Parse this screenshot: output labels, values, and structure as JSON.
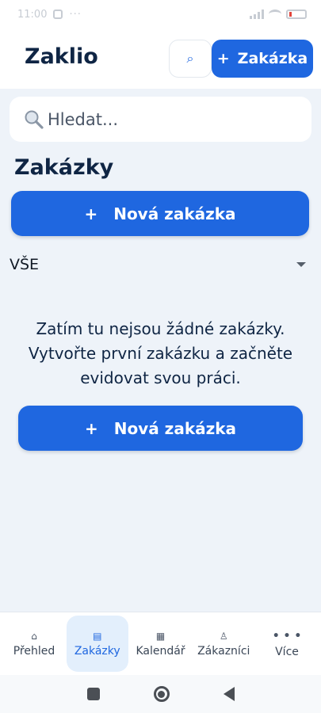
{
  "status_bar": {
    "time": "11:00",
    "dots": "···"
  },
  "header": {
    "app_title": "Zaklio",
    "search_icon": "⌕",
    "add_button_icon": "+",
    "add_button_label": "Zakázka"
  },
  "search": {
    "placeholder": "Hledat..."
  },
  "main": {
    "title": "Zakázky",
    "new_button_icon": "+",
    "new_button_label": "Nová zakázka",
    "filter_value": "VŠE",
    "empty_message": "Zatím tu nejsou žádné zakázky. Vytvořte první zakázku a začněte evidovat svou práci.",
    "empty_button_icon": "+",
    "empty_button_label": "Nová zakázka"
  },
  "bottom_nav": {
    "items": [
      {
        "label": "Přehled",
        "icon": "⌂",
        "icon_name": "home-icon"
      },
      {
        "label": "Zakázky",
        "icon": "▤",
        "icon_name": "list-icon"
      },
      {
        "label": "Kalendář",
        "icon": "▦",
        "icon_name": "calendar-icon"
      },
      {
        "label": "Zákazníci",
        "icon": "♙",
        "icon_name": "person-icon"
      },
      {
        "label": "Více",
        "icon": "• • •",
        "icon_name": "more-icon"
      }
    ],
    "active_index": 1
  },
  "colors": {
    "accent": "#1f67e0",
    "background": "#eef3f9",
    "text": "#0f2544",
    "nav_active_bg": "#e3effc"
  }
}
